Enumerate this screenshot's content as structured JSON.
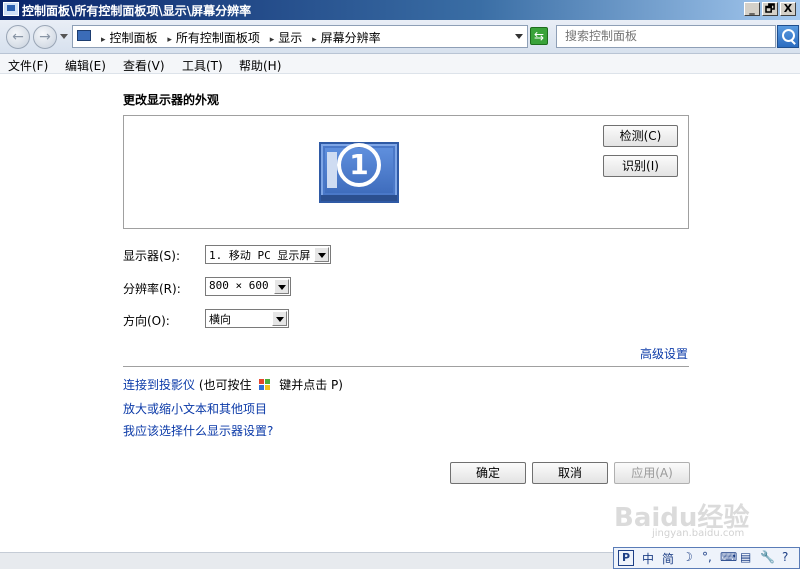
{
  "window": {
    "title": "控制面板\\所有控制面板项\\显示\\屏幕分辨率",
    "min": "_",
    "max": "🗗",
    "close": "X"
  },
  "address": {
    "breadcrumbs": [
      "控制面板",
      "所有控制面板项",
      "显示",
      "屏幕分辨率"
    ],
    "search_placeholder": "搜索控制面板"
  },
  "menu": [
    "文件(F)",
    "编辑(E)",
    "查看(V)",
    "工具(T)",
    "帮助(H)"
  ],
  "main": {
    "heading": "更改显示器的外观",
    "monitor_number": "1",
    "detect_label": "检测(C)",
    "identify_label": "识别(I)",
    "display_label": "显示器(S):",
    "display_value": "1. 移动 PC 显示屏",
    "resolution_label": "分辨率(R):",
    "resolution_value": "800 × 600",
    "orientation_label": "方向(O):",
    "orientation_value": "横向",
    "advanced_link": "高级设置",
    "projector_link_a": "连接到投影仪",
    "projector_link_b": "(也可按住",
    "projector_link_c": "键并点击 P)",
    "text_size_link": "放大或缩小文本和其他项目",
    "which_settings_link": "我应该选择什么显示器设置?",
    "ok_label": "确定",
    "cancel_label": "取消",
    "apply_label": "应用(A)"
  },
  "ime": {
    "logo": "P",
    "items": [
      "中",
      "简",
      "☽",
      "°,",
      "⌨",
      "▤",
      "🔧",
      "?"
    ]
  },
  "watermark": {
    "brand": "Baidu经验",
    "sub": "jingyan.baidu.com"
  },
  "colors": {
    "link": "#0b3aa8",
    "titlebar": "#0a246a"
  }
}
